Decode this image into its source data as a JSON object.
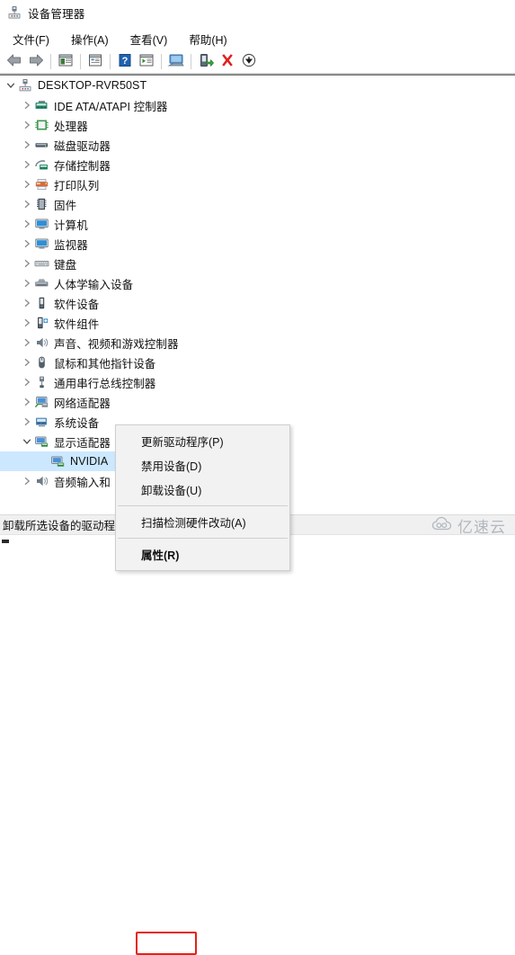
{
  "window": {
    "title": "设备管理器",
    "icon": "device-manager-icon"
  },
  "menubar": {
    "items": [
      {
        "label": "文件(F)",
        "name": "menu-file"
      },
      {
        "label": "操作(A)",
        "name": "menu-action"
      },
      {
        "label": "查看(V)",
        "name": "menu-view"
      },
      {
        "label": "帮助(H)",
        "name": "menu-help"
      }
    ]
  },
  "toolbar": {
    "buttons": [
      {
        "icon": "back-arrow-icon",
        "name": "toolbar-back"
      },
      {
        "icon": "forward-arrow-icon",
        "name": "toolbar-forward"
      },
      {
        "icon": "show-hide-console-tree-icon",
        "name": "toolbar-console-tree"
      },
      {
        "icon": "properties-icon",
        "name": "toolbar-properties"
      },
      {
        "icon": "help-icon",
        "name": "toolbar-help"
      },
      {
        "icon": "device-list-icon",
        "name": "toolbar-device-list"
      },
      {
        "icon": "scan-hardware-icon",
        "name": "toolbar-scan-hardware"
      },
      {
        "icon": "update-driver-icon",
        "name": "toolbar-update-driver"
      },
      {
        "icon": "uninstall-device-icon",
        "name": "toolbar-uninstall-device"
      },
      {
        "icon": "disable-device-icon",
        "name": "toolbar-disable-device"
      }
    ]
  },
  "tree": {
    "root": {
      "label": "DESKTOP-RVR50ST",
      "icon": "computer-root-icon",
      "expanded": true
    },
    "nodes": [
      {
        "label": "IDE ATA/ATAPI 控制器",
        "icon": "ide-controller-icon",
        "expanded": false
      },
      {
        "label": "处理器",
        "icon": "processor-icon",
        "expanded": false
      },
      {
        "label": "磁盘驱动器",
        "icon": "disk-drive-icon",
        "expanded": false
      },
      {
        "label": "存储控制器",
        "icon": "storage-controller-icon",
        "expanded": false
      },
      {
        "label": "打印队列",
        "icon": "print-queue-icon",
        "expanded": false
      },
      {
        "label": "固件",
        "icon": "firmware-icon",
        "expanded": false
      },
      {
        "label": "计算机",
        "icon": "computer-icon",
        "expanded": false
      },
      {
        "label": "监视器",
        "icon": "monitor-icon",
        "expanded": false
      },
      {
        "label": "键盘",
        "icon": "keyboard-icon",
        "expanded": false
      },
      {
        "label": "人体学输入设备",
        "icon": "hid-icon",
        "expanded": false
      },
      {
        "label": "软件设备",
        "icon": "software-device-icon",
        "expanded": false
      },
      {
        "label": "软件组件",
        "icon": "software-component-icon",
        "expanded": false
      },
      {
        "label": "声音、视频和游戏控制器",
        "icon": "sound-video-game-icon",
        "expanded": false
      },
      {
        "label": "鼠标和其他指针设备",
        "icon": "mouse-icon",
        "expanded": false
      },
      {
        "label": "通用串行总线控制器",
        "icon": "usb-controller-icon",
        "expanded": false
      },
      {
        "label": "网络适配器",
        "icon": "network-adapter-icon",
        "expanded": false
      },
      {
        "label": "系统设备",
        "icon": "system-device-icon",
        "expanded": false
      },
      {
        "label": "显示适配器",
        "icon": "display-adapter-icon",
        "expanded": true
      }
    ],
    "child": {
      "label": "NVIDIA",
      "icon": "display-adapter-child-icon",
      "selected": true
    },
    "after": [
      {
        "label": "音频输入和",
        "icon": "audio-input-output-icon",
        "expanded": false
      }
    ]
  },
  "context_menu": {
    "items": [
      {
        "label": "更新驱动程序(P)",
        "name": "ctx-update-driver",
        "type": "item"
      },
      {
        "label": "禁用设备(D)",
        "name": "ctx-disable-device",
        "type": "item"
      },
      {
        "label": "卸载设备(U)",
        "name": "ctx-uninstall-device",
        "type": "item"
      },
      {
        "label": "",
        "name": "ctx-separator-1",
        "type": "separator"
      },
      {
        "label": "扫描检测硬件改动(A)",
        "name": "ctx-scan-hardware",
        "type": "item"
      },
      {
        "label": "",
        "name": "ctx-separator-2",
        "type": "separator"
      },
      {
        "label": "属性(R)",
        "name": "ctx-properties",
        "type": "item",
        "highlighted": true
      }
    ],
    "highlight_color": "#e32119"
  },
  "statusbar": {
    "text": "卸载所选设备的驱动程..."
  },
  "watermark": {
    "text": "亿速云",
    "icon": "cloud-icon"
  },
  "colors": {
    "selection": "#cce8ff",
    "highlight_red": "#e32119",
    "statusbar_bg": "#f0f0f0"
  }
}
